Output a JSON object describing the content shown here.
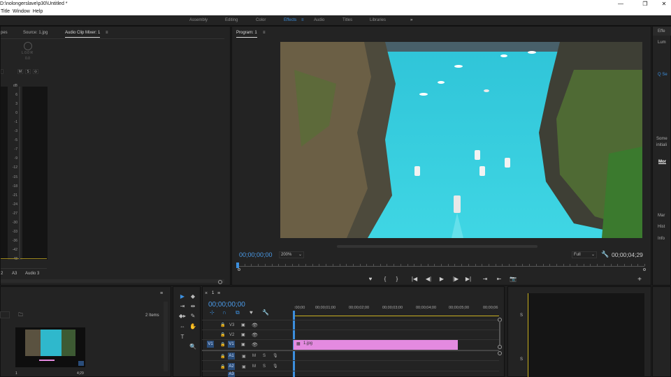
{
  "window": {
    "title": "D:\\nolongerslave\\p30\\Untitled *",
    "minimize": "—",
    "maximize": "❐",
    "close": "✕"
  },
  "menu": [
    "Title",
    "Window",
    "Help"
  ],
  "workspaces": [
    "Assembly",
    "Editing",
    "Color",
    "Effects",
    "Audio",
    "Titles",
    "Libraries"
  ],
  "workspace_active": "Effects",
  "workspace_menu_icon": "≡",
  "more_workspaces": "»",
  "source_panel": {
    "tabs": [
      "pes",
      "Source: 1.jpg",
      "Audio Clip Mixer: 1"
    ],
    "menu_icon": "≡",
    "pan_label": "L 0.0 R",
    "pan_value": "0.0",
    "buttons": [
      "M",
      "S",
      "⊙"
    ],
    "db_labels": [
      "dB",
      "6",
      "3",
      "0",
      "-1",
      "-3",
      "-5",
      "-7",
      "-9",
      "-12",
      "-15",
      "-18",
      "-21",
      "-24",
      "-27",
      "-30",
      "-33",
      "-36",
      "-42",
      "-48"
    ],
    "bottom": {
      "left_num": "2",
      "track": "A3",
      "channel": "Audio 3"
    }
  },
  "program_monitor": {
    "title": "Program: 1",
    "menu_icon": "≡",
    "timecode": "00;00;00;00",
    "zoom": "200%",
    "quality": "Full",
    "duration": "00;00;04;29",
    "controls": [
      "♥",
      "{",
      "}",
      "|◀",
      "◀|",
      "▶",
      "|▶",
      "▶|",
      "⇥",
      "⇤",
      "📷"
    ],
    "add": "+"
  },
  "project_panel": {
    "items_count": "2 Items",
    "thumb_start": "1",
    "thumb_dur": "4;29"
  },
  "tools": [
    "▶",
    "◆",
    "⇥",
    "⇹",
    "◆▸",
    "✎",
    "⇔",
    "✋",
    "T",
    "🔍"
  ],
  "timeline": {
    "sequence": "1",
    "menu_icon": "≡",
    "timecode": "00;00;00;00",
    "ruler": [
      ":00;00",
      "00;00;01;00",
      "00;00;02;00",
      "00;00;03;00",
      "00;00;04;00",
      "00;00;05;00",
      "00;00;06"
    ],
    "video_tracks": [
      "V3",
      "V2",
      "V1"
    ],
    "audio_tracks": [
      "A1",
      "A2",
      "A3"
    ],
    "source_v": "V1",
    "clip": {
      "name": "1.jpg"
    }
  },
  "right_panel": {
    "items": [
      "Effe",
      "Lum",
      "Q Se",
      "Some",
      "initiali",
      "Mor",
      "Mar",
      "Hist",
      "Info"
    ]
  },
  "audio_meter_right": {
    "labels": [
      "S",
      "S"
    ]
  },
  "colors": {
    "accent": "#3c8fde",
    "clip": "#e48ae0",
    "playhead": "#3c8fde"
  }
}
